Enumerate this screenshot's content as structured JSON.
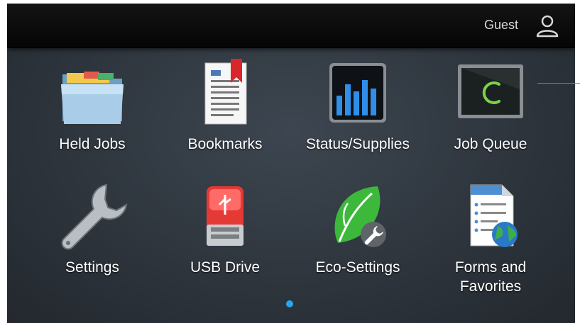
{
  "header": {
    "user_label": "Guest",
    "user_icon": "user-icon"
  },
  "apps": [
    {
      "label": "Held Jobs",
      "icon": "folder-icon"
    },
    {
      "label": "Bookmarks",
      "icon": "bookmark-document-icon"
    },
    {
      "label": "Status/Supplies",
      "icon": "bar-chart-icon"
    },
    {
      "label": "Job Queue",
      "icon": "job-queue-monitor-icon"
    },
    {
      "label": "Settings",
      "icon": "wrench-icon"
    },
    {
      "label": "USB Drive",
      "icon": "usb-drive-icon"
    },
    {
      "label": "Eco-Settings",
      "icon": "leaf-wrench-icon"
    },
    {
      "label": "Forms and Favorites",
      "label_line1": "Forms and",
      "label_line2": "Favorites",
      "icon": "forms-globe-icon"
    }
  ],
  "pager": {
    "active_page": 1,
    "color": "#2aa7ea"
  },
  "colors": {
    "accent": "#2aa7ea",
    "callout_line": "#3aa870"
  }
}
